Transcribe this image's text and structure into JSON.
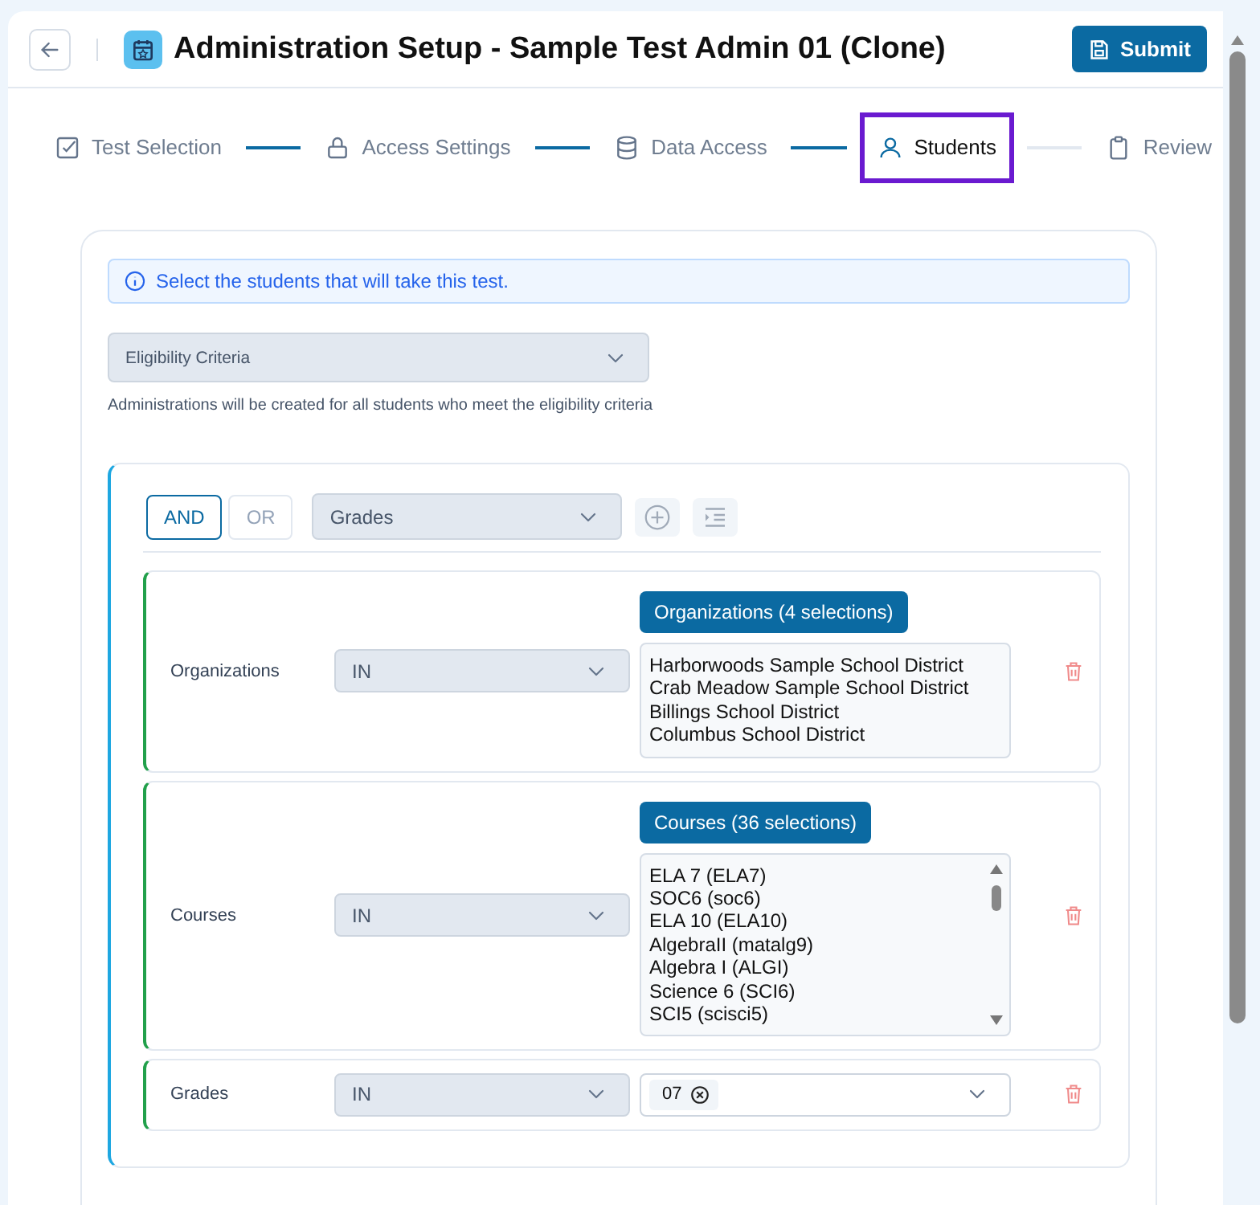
{
  "header": {
    "title": "Administration Setup - Sample Test Admin 01 (Clone)",
    "submit": "Submit"
  },
  "steps": [
    {
      "label": "Test Selection",
      "completed": true,
      "selected": false
    },
    {
      "label": "Access Settings",
      "completed": true,
      "selected": false
    },
    {
      "label": "Data Access",
      "completed": true,
      "selected": false
    },
    {
      "label": "Students",
      "completed": false,
      "selected": true
    },
    {
      "label": "Review",
      "selected": false
    }
  ],
  "info": "Select the students that will take this test.",
  "eligibility": {
    "value": "Eligibility Criteria",
    "note": "Administrations will be created for all students who meet the eligibility criteria"
  },
  "group": {
    "operators": [
      {
        "label": "AND",
        "selected": true
      },
      {
        "label": "OR",
        "selected": false
      }
    ],
    "field": "Grades",
    "rules": [
      {
        "kind": "list",
        "label": "Organizations",
        "operator": "IN",
        "badge": "Organizations (4 selections)",
        "items": [
          "Harborwoods Sample School District",
          "Crab Meadow Sample School District",
          "Billings School District",
          "Columbus School District"
        ]
      },
      {
        "kind": "list",
        "label": "Courses",
        "operator": "IN",
        "badge": "Courses (36 selections)",
        "items": [
          "ELA 7 (ELA7)",
          "SOC6 (soc6)",
          "ELA 10 (ELA10)",
          "AlgebraII (matalg9)",
          "Algebra I (ALGI)",
          "Science 6 (SCI6)",
          "SCI5 (scisci5)"
        ]
      },
      {
        "kind": "tags",
        "label": "Grades",
        "operator": "IN",
        "tags": [
          "07"
        ]
      }
    ]
  }
}
